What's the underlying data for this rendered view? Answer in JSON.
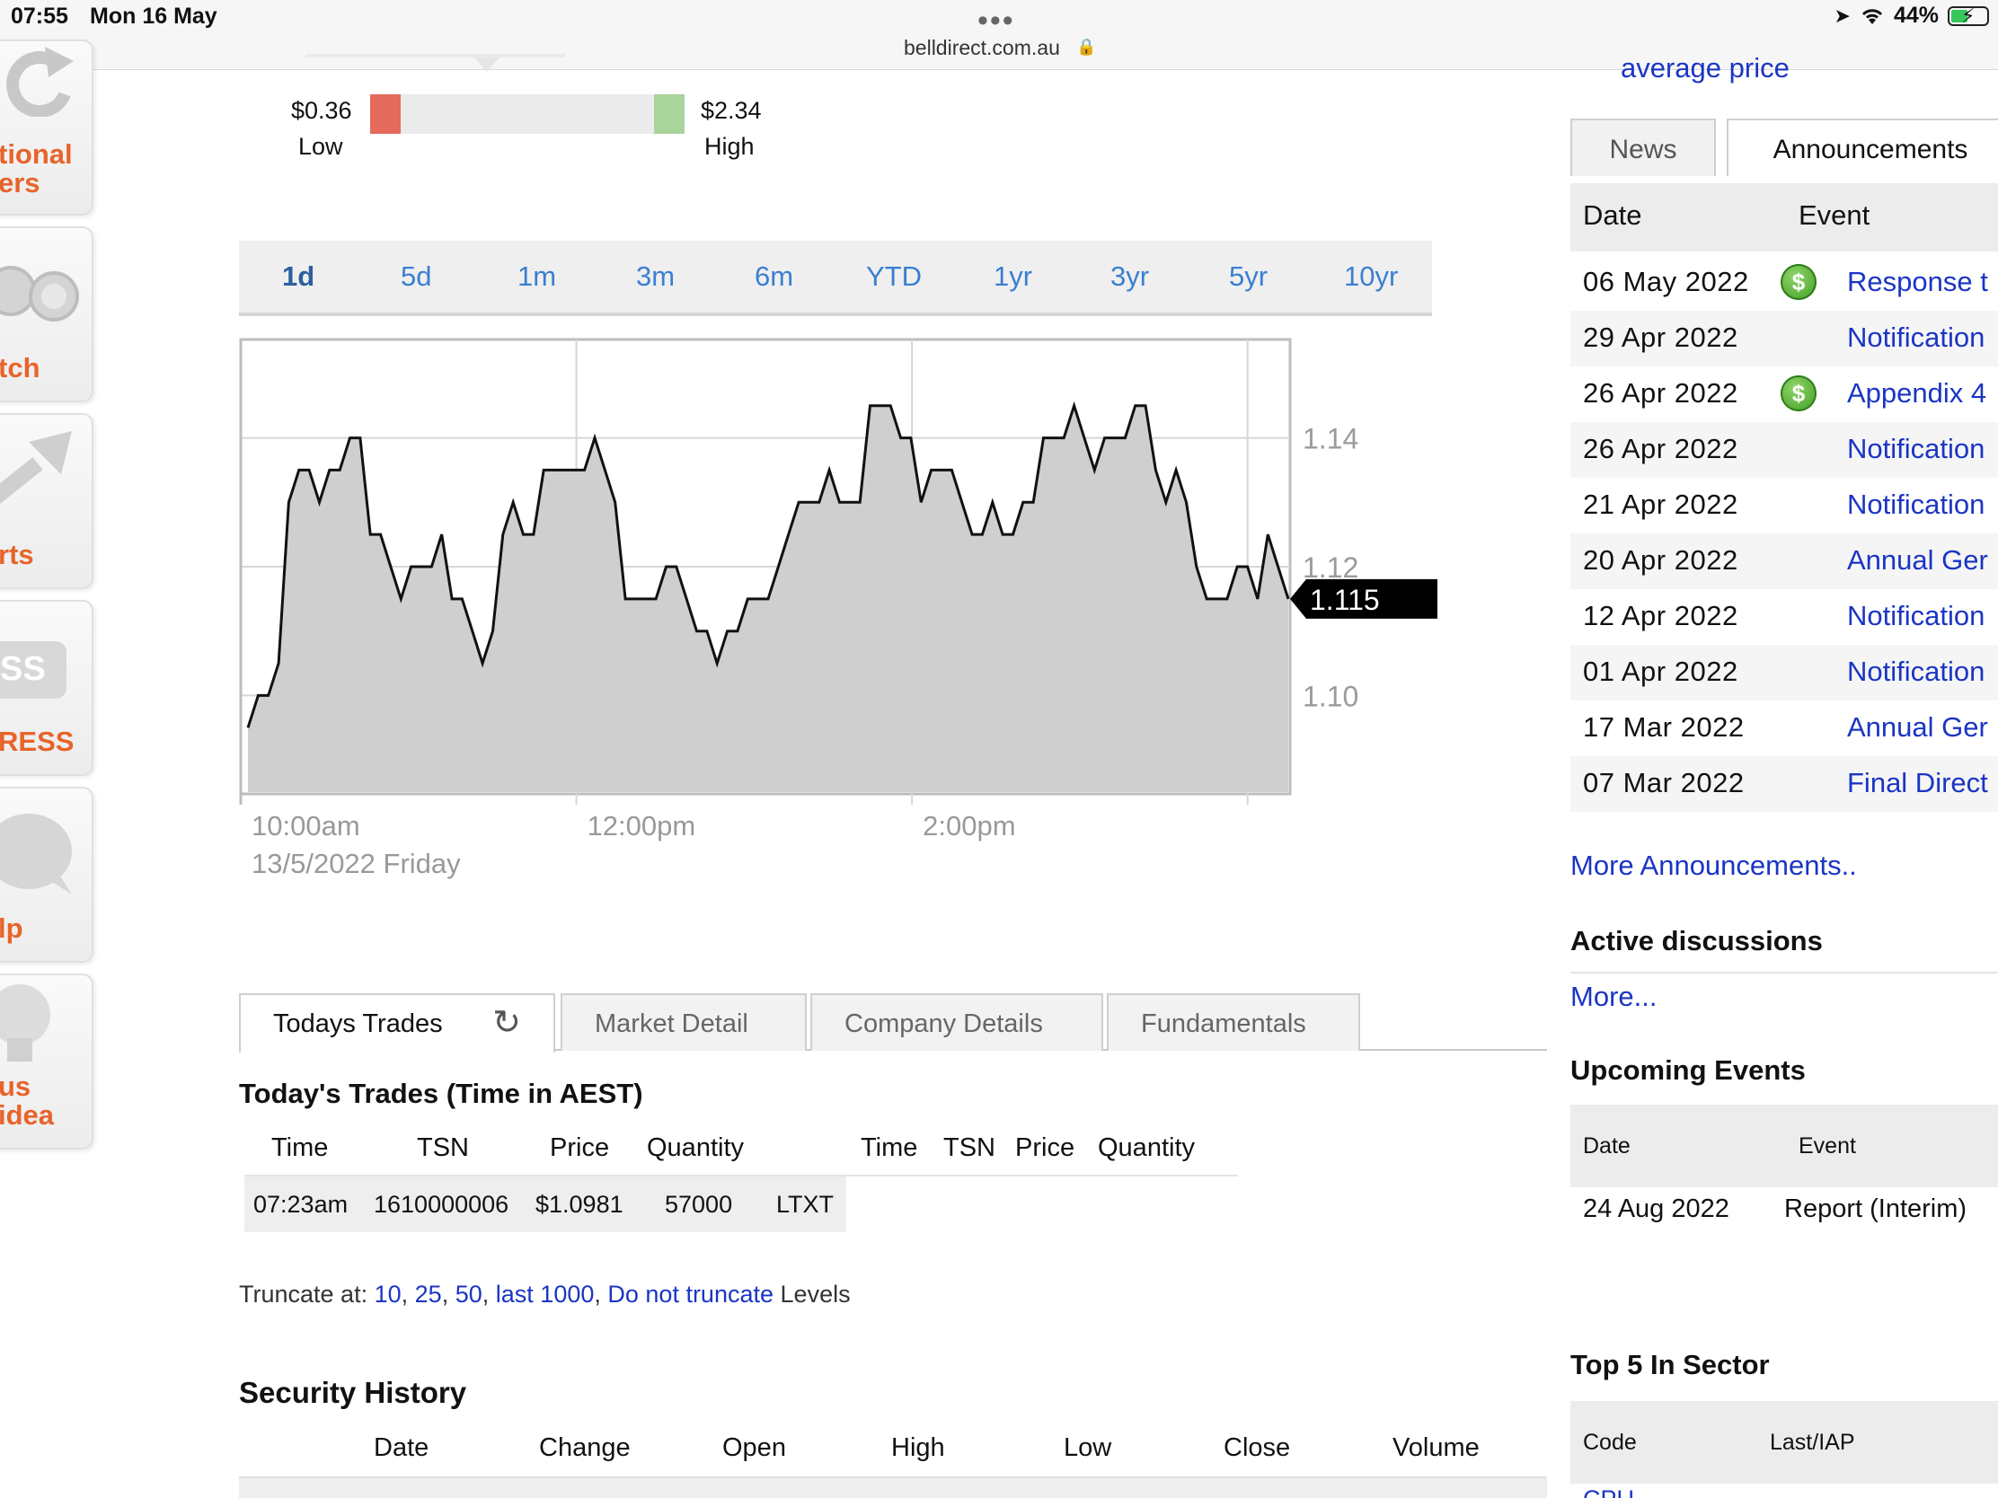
{
  "status_bar": {
    "time": "07:55",
    "date": "Mon 16 May",
    "url": "belldirect.com.au",
    "battery": "44%"
  },
  "sidebar": {
    "items": [
      {
        "label_line1": "tional",
        "label_line2": "ers",
        "icon": "refresh-arrow-icon"
      },
      {
        "label_line1": "tch",
        "label_line2": "",
        "icon": "binoculars-icon"
      },
      {
        "label_line1": "rts",
        "label_line2": "",
        "icon": "chart-arrow-icon"
      },
      {
        "label_line1": "RESS",
        "label_line2": "",
        "icon": "express-badge-icon",
        "badge": "SS"
      },
      {
        "label_line1": "lp",
        "label_line2": "",
        "icon": "help-bubble-icon"
      },
      {
        "label_line1": "us",
        "label_line2": "idea",
        "icon": "lightbulb-icon"
      }
    ]
  },
  "price_range": {
    "low_value": "$0.36",
    "low_label": "Low",
    "high_value": "$2.34",
    "high_label": "High"
  },
  "periods": [
    "1d",
    "5d",
    "1m",
    "3m",
    "6m",
    "YTD",
    "1yr",
    "3yr",
    "5yr",
    "10yr"
  ],
  "active_period": "1d",
  "chart_data": {
    "type": "area",
    "x_tick_labels": [
      "10:00am",
      "12:00pm",
      "2:00pm"
    ],
    "x_sublabel": "13/5/2022 Friday",
    "y_tick_labels": [
      "1.14",
      "1.12",
      "1.10"
    ],
    "ylim": [
      1.085,
      1.155
    ],
    "last_price_label": "1.115",
    "last_price": 1.115,
    "series": [
      {
        "values": [
          1.095,
          1.1,
          1.1,
          1.105,
          1.13,
          1.135,
          1.135,
          1.13,
          1.135,
          1.135,
          1.14,
          1.14,
          1.125,
          1.125,
          1.12,
          1.115,
          1.12,
          1.12,
          1.12,
          1.125,
          1.115,
          1.115,
          1.11,
          1.105,
          1.11,
          1.125,
          1.13,
          1.125,
          1.125,
          1.135,
          1.135,
          1.135,
          1.135,
          1.135,
          1.14,
          1.135,
          1.13,
          1.115,
          1.115,
          1.115,
          1.115,
          1.12,
          1.12,
          1.115,
          1.11,
          1.11,
          1.105,
          1.11,
          1.11,
          1.115,
          1.115,
          1.115,
          1.12,
          1.125,
          1.13,
          1.13,
          1.13,
          1.135,
          1.13,
          1.13,
          1.13,
          1.145,
          1.145,
          1.145,
          1.14,
          1.14,
          1.13,
          1.135,
          1.135,
          1.135,
          1.13,
          1.125,
          1.125,
          1.13,
          1.125,
          1.125,
          1.13,
          1.13,
          1.14,
          1.14,
          1.14,
          1.145,
          1.14,
          1.135,
          1.14,
          1.14,
          1.14,
          1.145,
          1.145,
          1.135,
          1.13,
          1.135,
          1.13,
          1.12,
          1.115,
          1.115,
          1.115,
          1.12,
          1.12,
          1.115,
          1.125,
          1.12,
          1.115
        ]
      }
    ],
    "grid": true
  },
  "bottom_tabs": [
    "Todays Trades",
    "Market Detail",
    "Company Details",
    "Fundamentals"
  ],
  "todays_trades": {
    "title": "Today's Trades (Time in AEST)",
    "headers_left": [
      "Time",
      "TSN",
      "Price",
      "Quantity"
    ],
    "headers_right": [
      "Time",
      "TSN",
      "Price",
      "Quantity"
    ],
    "rows": [
      {
        "time": "07:23am",
        "tsn": "1610000006",
        "price": "$1.0981",
        "quantity": "57000",
        "cond": "LTXT"
      }
    ]
  },
  "truncate": {
    "prefix": "Truncate at:",
    "options": [
      "10",
      "25",
      "50",
      "last 1000",
      "Do not truncate"
    ],
    "suffix": "Levels"
  },
  "security_history": {
    "title": "Security History",
    "headers": [
      "Date",
      "Change",
      "Open",
      "High",
      "Low",
      "Close",
      "Volume"
    ]
  },
  "right_column": {
    "top_link": "average price",
    "tabs": [
      "News",
      "Announcements"
    ],
    "announcements_header": {
      "date": "Date",
      "event": "Event"
    },
    "announcements": [
      {
        "date": "06 May 2022",
        "icon": true,
        "event": "Response t"
      },
      {
        "date": "29 Apr 2022",
        "icon": false,
        "event": "Notification"
      },
      {
        "date": "26 Apr 2022",
        "icon": true,
        "event": "Appendix 4"
      },
      {
        "date": "26 Apr 2022",
        "icon": false,
        "event": "Notification"
      },
      {
        "date": "21 Apr 2022",
        "icon": false,
        "event": "Notification"
      },
      {
        "date": "20 Apr 2022",
        "icon": false,
        "event": "Annual Ger"
      },
      {
        "date": "12 Apr 2022",
        "icon": false,
        "event": "Notification"
      },
      {
        "date": "01 Apr 2022",
        "icon": false,
        "event": "Notification"
      },
      {
        "date": "17 Mar 2022",
        "icon": false,
        "event": "Annual Ger"
      },
      {
        "date": "07 Mar 2022",
        "icon": false,
        "event": "Final Direct"
      }
    ],
    "more_announcements": "More Announcements..",
    "active_discussions_title": "Active discussions",
    "more_link": "More...",
    "upcoming_title": "Upcoming Events",
    "upcoming_header": {
      "date": "Date",
      "event": "Event"
    },
    "upcoming": [
      {
        "date": "24 Aug 2022",
        "event": "Report (Interim)"
      }
    ],
    "top5_title": "Top 5 In Sector",
    "top5_header": {
      "code": "Code",
      "last": "Last/IAP"
    },
    "top5_first_code": "CPU"
  }
}
